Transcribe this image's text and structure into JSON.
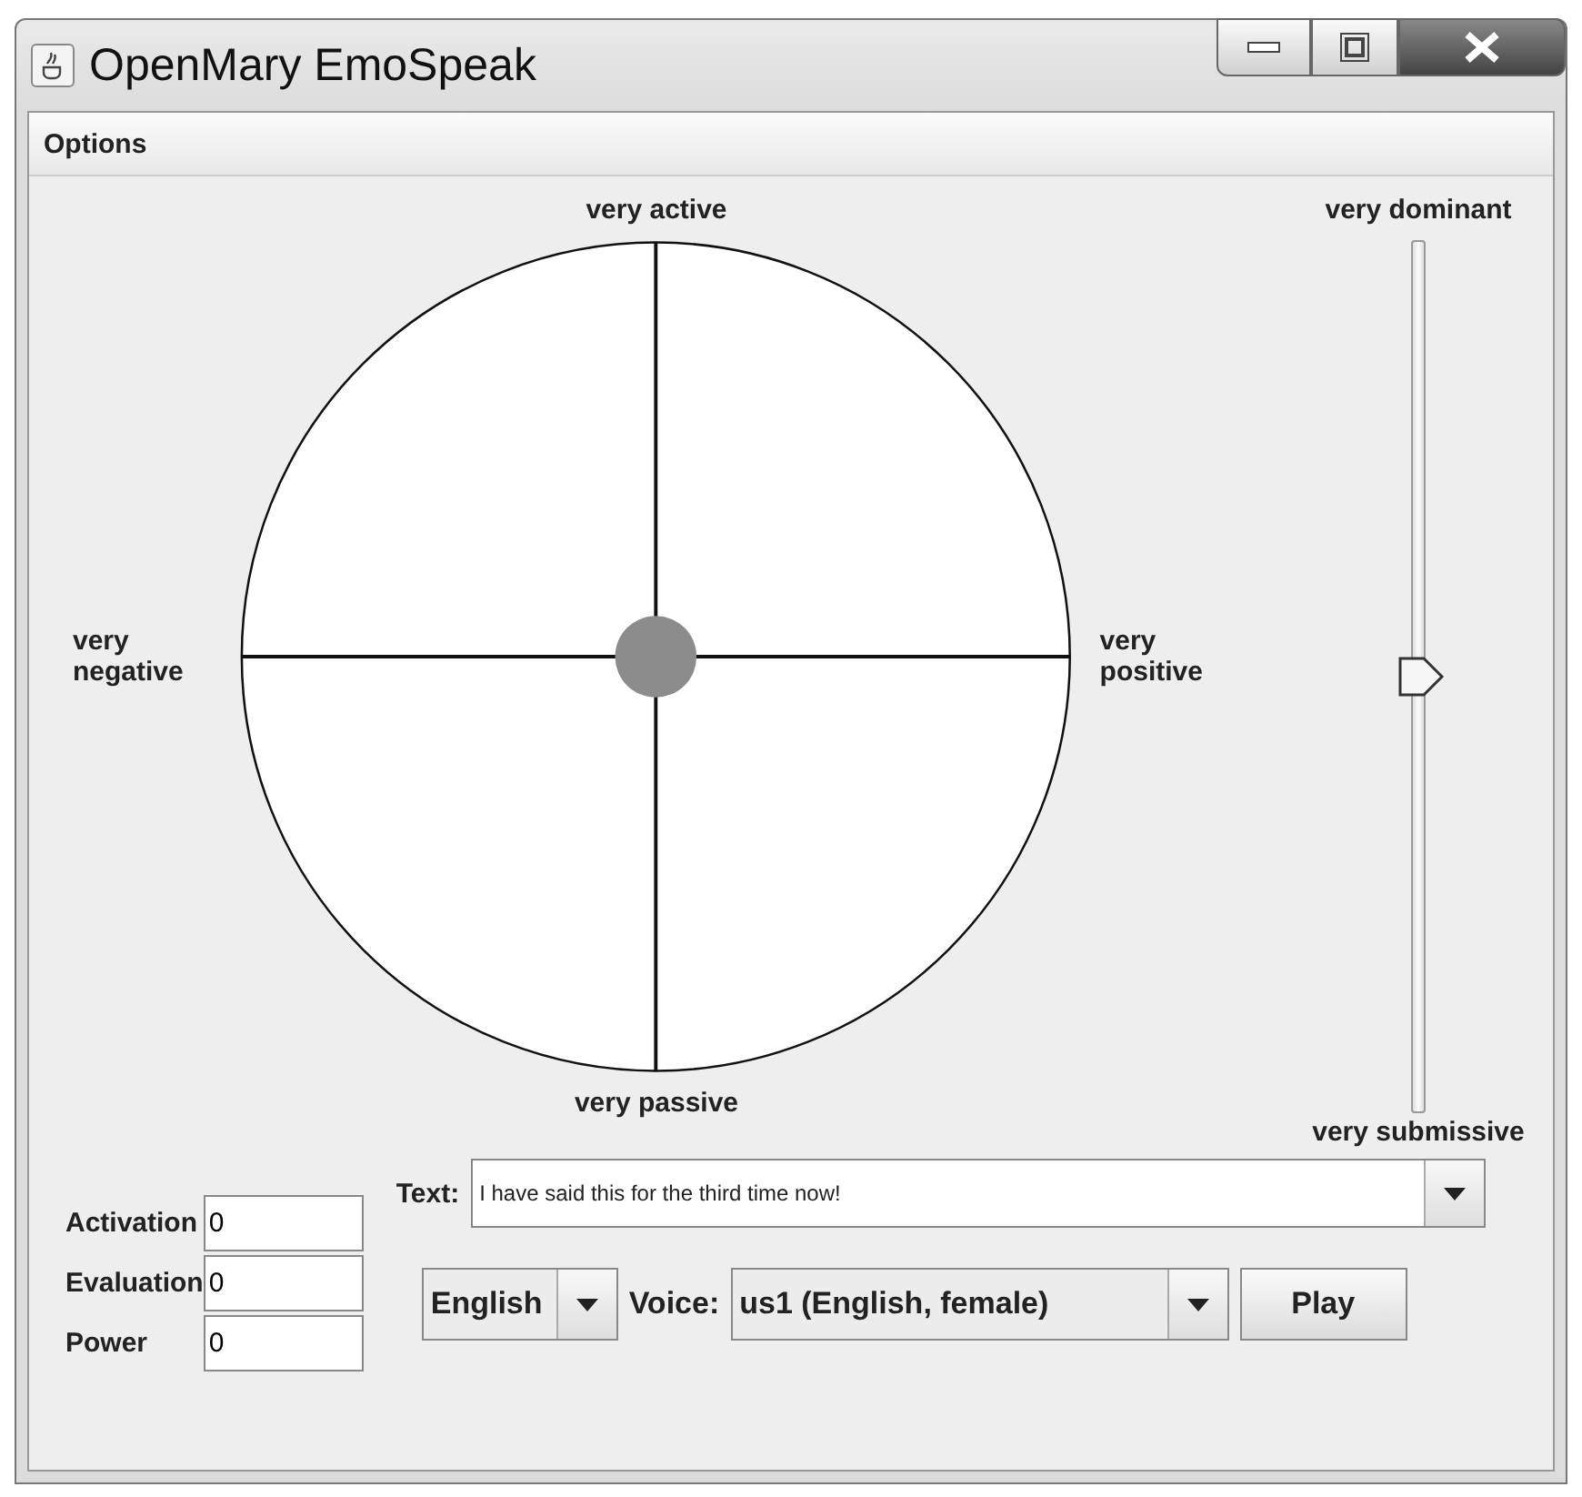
{
  "window": {
    "title": "OpenMary EmoSpeak"
  },
  "menu": [
    "Options"
  ],
  "circle": {
    "top": "very active",
    "bottom": "very passive",
    "left": "very negative",
    "right": "very positive"
  },
  "dominance": {
    "top": "very dominant",
    "bottom": "very submissive",
    "level": 0.5
  },
  "fields": [
    {
      "label": "Activation",
      "value": "0"
    },
    {
      "label": "Evaluation",
      "value": "0"
    },
    {
      "label": "Power",
      "value": "0"
    }
  ],
  "text": {
    "label": "Text:",
    "value": "I have said this for the third time now!"
  },
  "language": "English",
  "voice": {
    "label": "Voice:",
    "value": "us1 (English, female)"
  },
  "play_button": "Play"
}
